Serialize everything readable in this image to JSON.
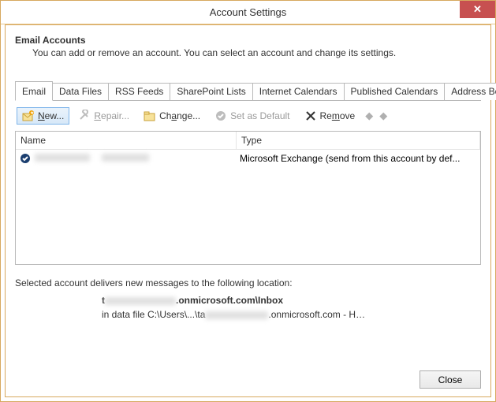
{
  "window": {
    "title": "Account Settings",
    "close": "✕"
  },
  "header": {
    "title": "Email Accounts",
    "subtitle": "You can add or remove an account. You can select an account and change its settings."
  },
  "tabs": [
    {
      "label": "Email",
      "active": true
    },
    {
      "label": "Data Files"
    },
    {
      "label": "RSS Feeds"
    },
    {
      "label": "SharePoint Lists"
    },
    {
      "label": "Internet Calendars"
    },
    {
      "label": "Published Calendars"
    },
    {
      "label": "Address Books"
    }
  ],
  "toolbar": {
    "new_prefix": "N",
    "new_rest": "ew...",
    "repair_prefix": "R",
    "repair_rest": "epair...",
    "change_prefix": "Ch",
    "change_underline": "a",
    "change_rest": "nge...",
    "default": "Set as Default",
    "remove_prefix": "Re",
    "remove_underline": "m",
    "remove_rest": "ove"
  },
  "list": {
    "col_name": "Name",
    "col_type": "Type",
    "rows": [
      {
        "name": "t",
        "type": "Microsoft Exchange (send from this account by def..."
      }
    ]
  },
  "delivery": {
    "intro": "Selected account delivers new messages to the following location:",
    "line1_prefix": "t",
    "line1_suffix": ".onmicrosoft.com\\Inbox",
    "line2_prefix": "in data file C:\\Users\\...\\ta",
    "line2_suffix": ".onmicrosoft.com - H…"
  },
  "buttons": {
    "close": "Close"
  }
}
